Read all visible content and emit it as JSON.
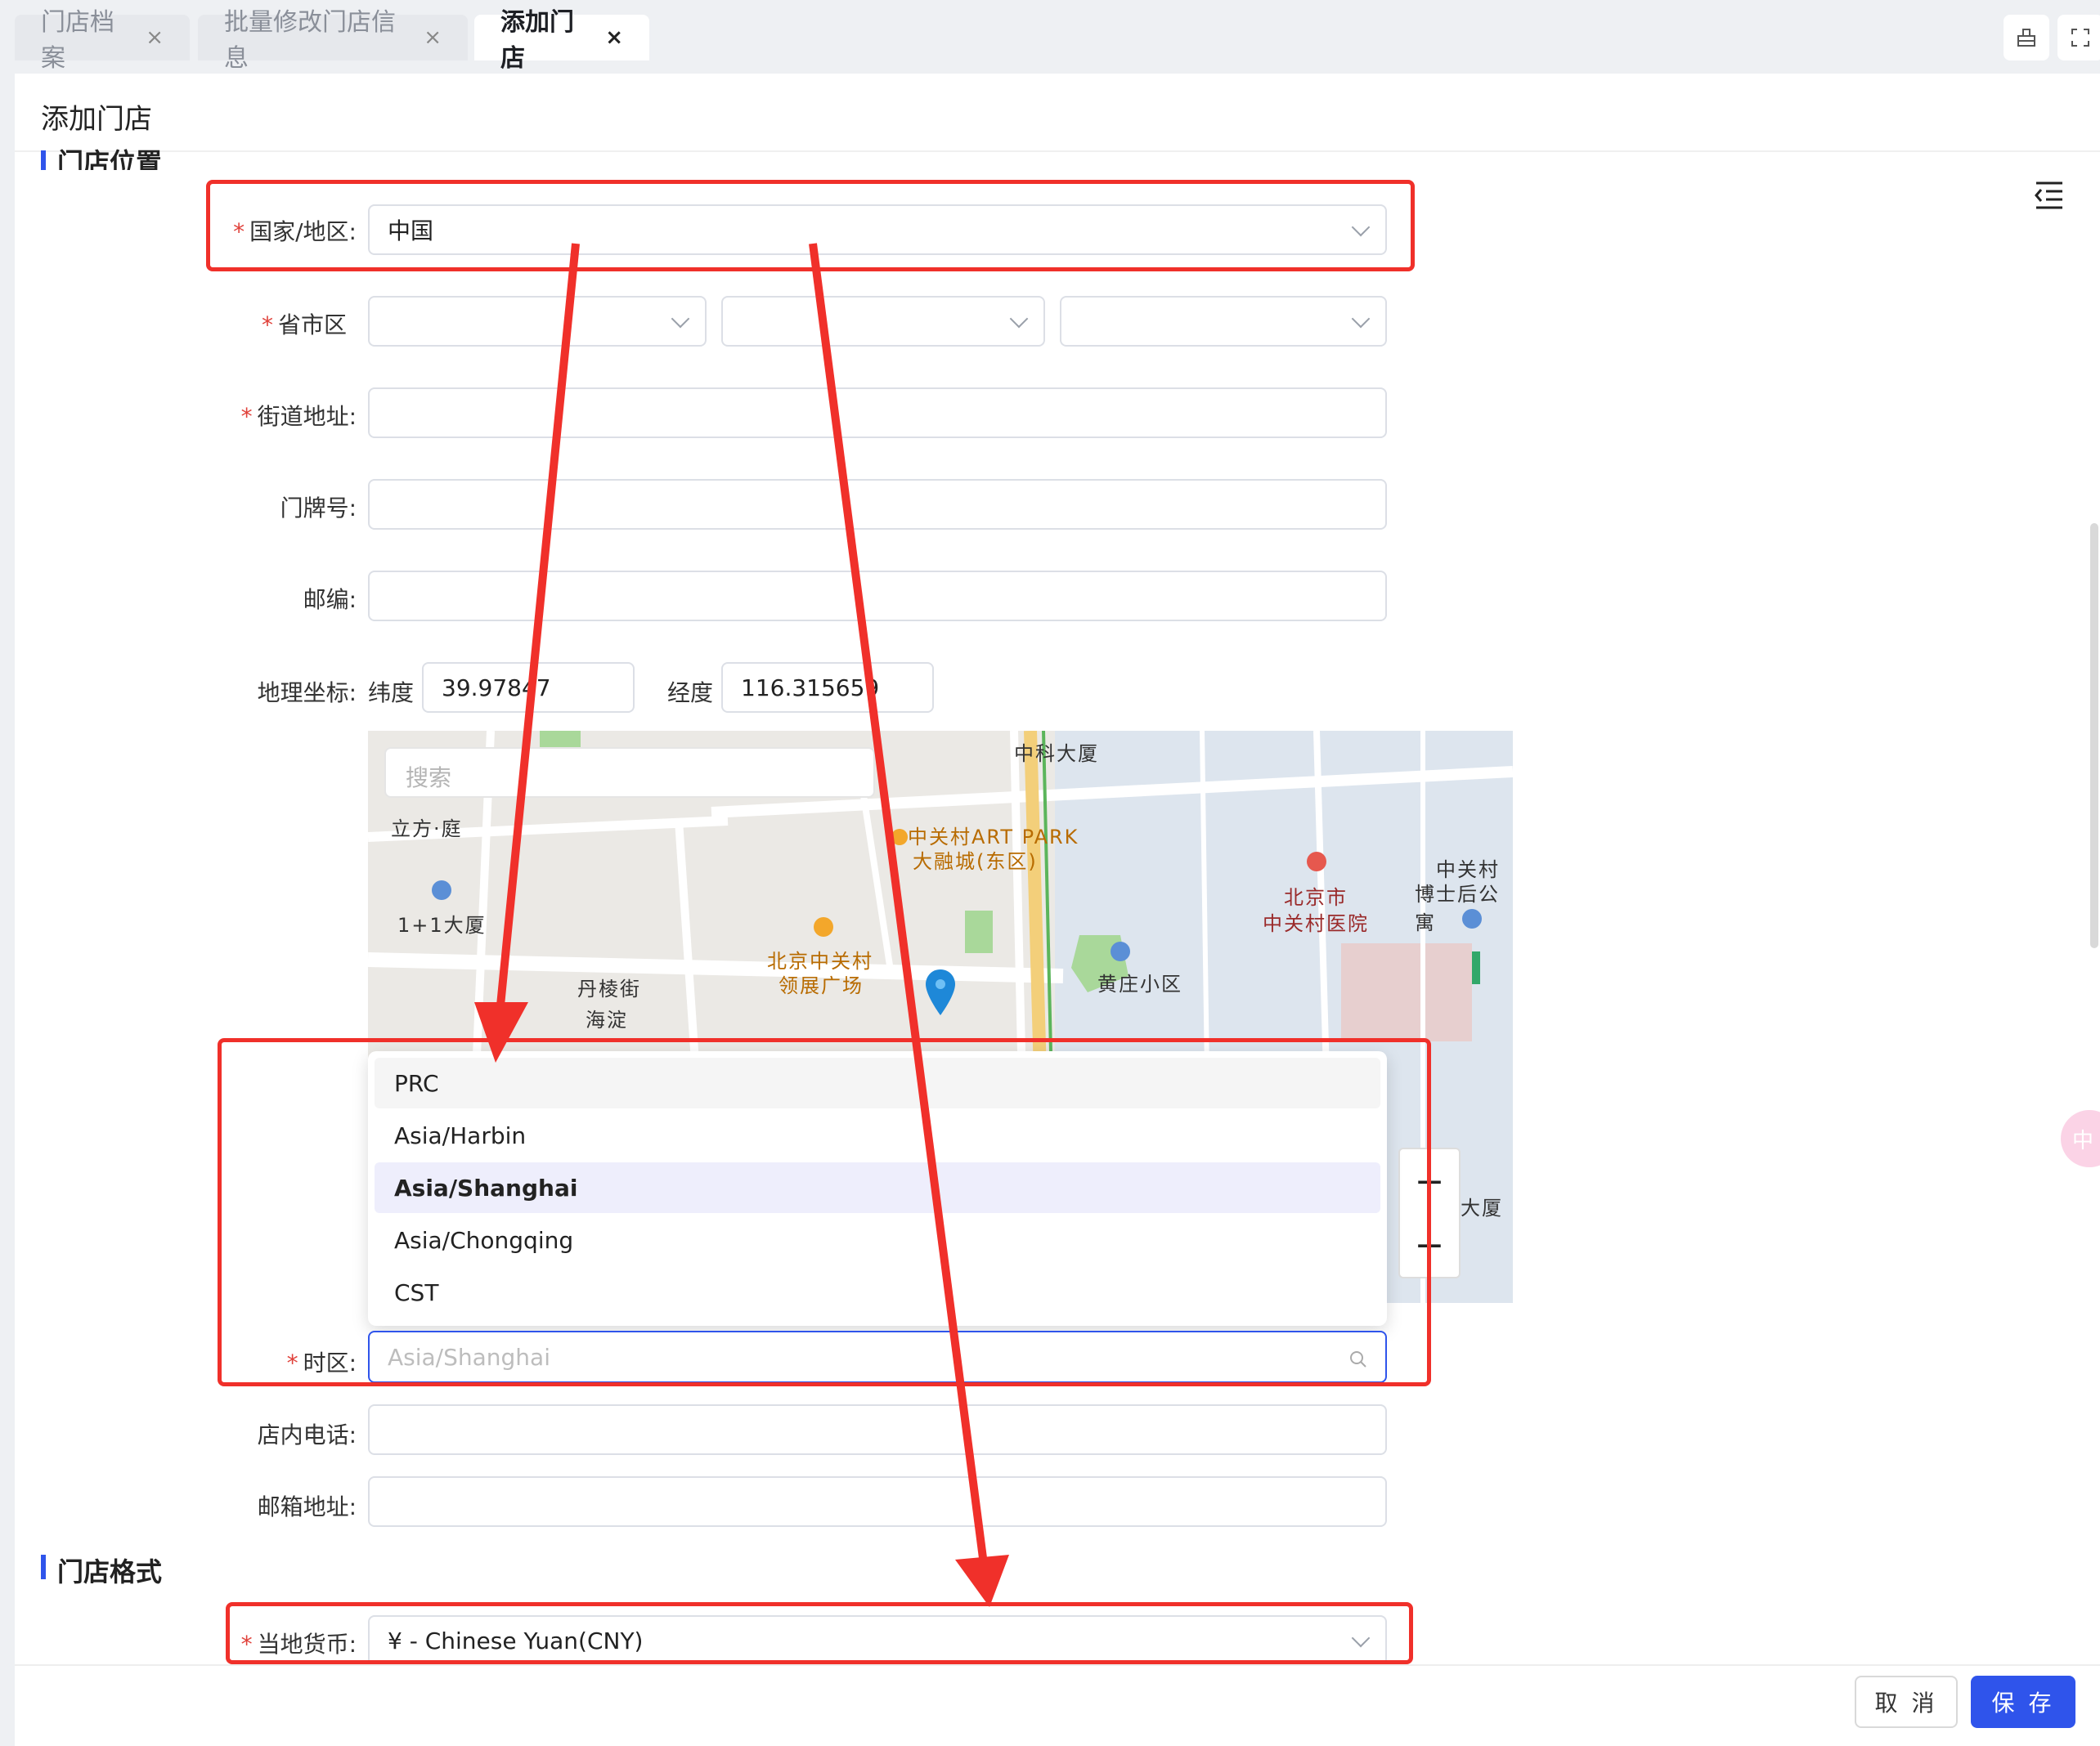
{
  "tabs": [
    {
      "label": "门店档案",
      "close": "×"
    },
    {
      "label": "批量修改门店信息",
      "close": "×"
    },
    {
      "label": "添加门店",
      "close": "×"
    }
  ],
  "header": {
    "title": "添加门店"
  },
  "sections": {
    "location": "门店位置",
    "format": "门店格式"
  },
  "form": {
    "required_mark": "*",
    "country_label": "国家/地区:",
    "country_value": "中国",
    "province_label": "省市区",
    "street_label": "街道地址:",
    "house_label": "门牌号:",
    "zip_label": "邮编:",
    "geo_label": "地理坐标:",
    "lat_label": "纬度",
    "lat_value": "39.97847",
    "lng_label": "经度",
    "lng_value": "116.315659",
    "tz_label": "时区:",
    "tz_placeholder": "Asia/Shanghai",
    "phone_label": "店内电话:",
    "email_label": "邮箱地址:",
    "currency_label": "当地货币:",
    "currency_value": "¥ - Chinese Yuan(CNY)"
  },
  "map": {
    "search_placeholder": "搜索",
    "labels": {
      "zkdx": "中科大厦",
      "lifang": "立方·庭",
      "artpark1": "中关村ART PARK",
      "artpark2": "大融城(东区)",
      "hospital1": "北京市",
      "hospital2": "中关村医院",
      "zgc1": "中关村",
      "zgc2": "博士后公寓",
      "oneplus": "1+1大厦",
      "lingzhan1": "北京中关村",
      "lingzhan2": "领展广场",
      "danlengjie": "丹棱街",
      "huangzhuang": "黄庄小区",
      "haidian": "海淀",
      "dasha": "大厦"
    },
    "zoom_in": "+",
    "zoom_out": "−"
  },
  "timezone_options": [
    "PRC",
    "Asia/Harbin",
    "Asia/Shanghai",
    "Asia/Chongqing",
    "CST"
  ],
  "footer": {
    "cancel": "取 消",
    "save": "保 存"
  },
  "colors": {
    "primary": "#2f54eb",
    "annotation_red": "#f0302a",
    "required": "#e0413a"
  },
  "icons": {
    "list": "outdent-list-icon",
    "search": "search-icon",
    "chevron": "chevron-down-icon",
    "pin": "map-pin-icon"
  }
}
